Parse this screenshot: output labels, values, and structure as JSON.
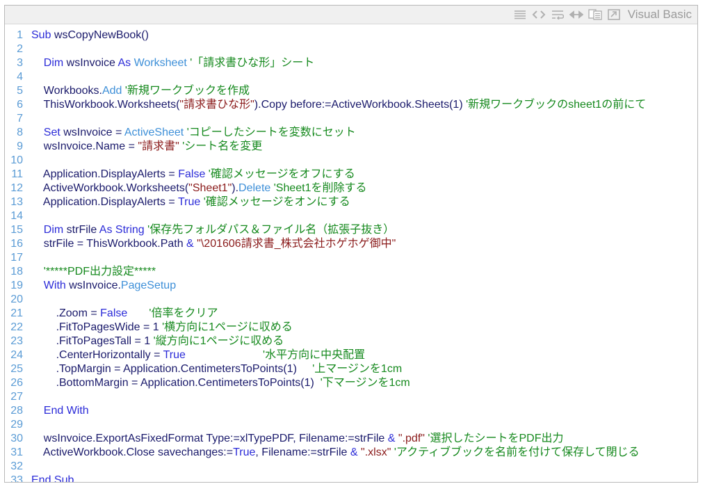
{
  "toolbar": {
    "icons": [
      "view-plain-icon",
      "view-source-icon",
      "wrap-lines-icon",
      "expand-icon",
      "copy-icon",
      "popup-icon"
    ],
    "language": "Visual Basic"
  },
  "colors": {
    "keyword": "#2b2bd8",
    "type": "#3d8fd8",
    "comment": "#15891d",
    "string": "#8a1a1a",
    "plain": "#1a1a6b",
    "line_number": "#5a9bd5"
  },
  "lines": [
    {
      "n": "1",
      "indent": "",
      "tokens": [
        {
          "t": "kw",
          "v": "Sub"
        },
        {
          "t": "pl",
          "v": " wsCopyNewBook()"
        }
      ]
    },
    {
      "n": "2",
      "indent": "",
      "tokens": []
    },
    {
      "n": "3",
      "indent": "    ",
      "tokens": [
        {
          "t": "kw",
          "v": "Dim"
        },
        {
          "t": "pl",
          "v": " wsInvoice "
        },
        {
          "t": "kw",
          "v": "As"
        },
        {
          "t": "pl",
          "v": " "
        },
        {
          "t": "ty",
          "v": "Worksheet"
        },
        {
          "t": "pl",
          "v": " "
        },
        {
          "t": "cm",
          "v": "'「請求書ひな形」シート"
        }
      ]
    },
    {
      "n": "4",
      "indent": "",
      "tokens": []
    },
    {
      "n": "5",
      "indent": "    ",
      "tokens": [
        {
          "t": "pl",
          "v": "Workbooks."
        },
        {
          "t": "ty",
          "v": "Add"
        },
        {
          "t": "pl",
          "v": " "
        },
        {
          "t": "cm",
          "v": "'新規ワークブックを作成"
        }
      ]
    },
    {
      "n": "6",
      "indent": "    ",
      "tokens": [
        {
          "t": "pl",
          "v": "ThisWorkbook.Worksheets("
        },
        {
          "t": "st",
          "v": "\"請求書ひな形\""
        },
        {
          "t": "pl",
          "v": ").Copy before:=ActiveWorkbook.Sheets(1) "
        },
        {
          "t": "cm",
          "v": "'新規ワークブックのsheet1の前にて"
        }
      ]
    },
    {
      "n": "7",
      "indent": "",
      "tokens": []
    },
    {
      "n": "8",
      "indent": "    ",
      "tokens": [
        {
          "t": "kw",
          "v": "Set"
        },
        {
          "t": "pl",
          "v": " wsInvoice = "
        },
        {
          "t": "ty",
          "v": "ActiveSheet"
        },
        {
          "t": "pl",
          "v": " "
        },
        {
          "t": "cm",
          "v": "'コピーしたシートを変数にセット"
        }
      ]
    },
    {
      "n": "9",
      "indent": "    ",
      "tokens": [
        {
          "t": "pl",
          "v": "wsInvoice.Name = "
        },
        {
          "t": "st",
          "v": "\"請求書\""
        },
        {
          "t": "pl",
          "v": " "
        },
        {
          "t": "cm",
          "v": "'シート名を変更"
        }
      ]
    },
    {
      "n": "10",
      "indent": "",
      "tokens": []
    },
    {
      "n": "11",
      "indent": "    ",
      "tokens": [
        {
          "t": "pl",
          "v": "Application.DisplayAlerts = "
        },
        {
          "t": "kw",
          "v": "False"
        },
        {
          "t": "pl",
          "v": " "
        },
        {
          "t": "cm",
          "v": "'確認メッセージをオフにする"
        }
      ]
    },
    {
      "n": "12",
      "indent": "    ",
      "tokens": [
        {
          "t": "pl",
          "v": "ActiveWorkbook.Worksheets("
        },
        {
          "t": "st",
          "v": "\"Sheet1\""
        },
        {
          "t": "pl",
          "v": ")."
        },
        {
          "t": "ty",
          "v": "Delete"
        },
        {
          "t": "pl",
          "v": " "
        },
        {
          "t": "cm",
          "v": "'Sheet1を削除する"
        }
      ]
    },
    {
      "n": "13",
      "indent": "    ",
      "tokens": [
        {
          "t": "pl",
          "v": "Application.DisplayAlerts = "
        },
        {
          "t": "kw",
          "v": "True"
        },
        {
          "t": "pl",
          "v": " "
        },
        {
          "t": "cm",
          "v": "'確認メッセージをオンにする"
        }
      ]
    },
    {
      "n": "14",
      "indent": "",
      "tokens": []
    },
    {
      "n": "15",
      "indent": "    ",
      "tokens": [
        {
          "t": "kw",
          "v": "Dim"
        },
        {
          "t": "pl",
          "v": " strFile "
        },
        {
          "t": "kw",
          "v": "As"
        },
        {
          "t": "pl",
          "v": " "
        },
        {
          "t": "kw",
          "v": "String"
        },
        {
          "t": "pl",
          "v": " "
        },
        {
          "t": "cm",
          "v": "'保存先フォルダパス＆ファイル名（拡張子抜き）"
        }
      ]
    },
    {
      "n": "16",
      "indent": "    ",
      "tokens": [
        {
          "t": "pl",
          "v": "strFile = ThisWorkbook.Path "
        },
        {
          "t": "kw",
          "v": "&"
        },
        {
          "t": "pl",
          "v": " "
        },
        {
          "t": "st",
          "v": "\"\\201606請求書_株式会社ホゲホゲ御中\""
        }
      ]
    },
    {
      "n": "17",
      "indent": "",
      "tokens": []
    },
    {
      "n": "18",
      "indent": "    ",
      "tokens": [
        {
          "t": "cm",
          "v": "'*****PDF出力設定*****"
        }
      ]
    },
    {
      "n": "19",
      "indent": "    ",
      "tokens": [
        {
          "t": "kw",
          "v": "With"
        },
        {
          "t": "pl",
          "v": " wsInvoice."
        },
        {
          "t": "ty",
          "v": "PageSetup"
        }
      ]
    },
    {
      "n": "20",
      "indent": "",
      "tokens": []
    },
    {
      "n": "21",
      "indent": "        ",
      "tokens": [
        {
          "t": "pl",
          "v": ".Zoom = "
        },
        {
          "t": "kw",
          "v": "False"
        },
        {
          "t": "pl",
          "v": "       "
        },
        {
          "t": "cm",
          "v": "'倍率をクリア"
        }
      ]
    },
    {
      "n": "22",
      "indent": "        ",
      "tokens": [
        {
          "t": "pl",
          "v": ".FitToPagesWide = 1 "
        },
        {
          "t": "cm",
          "v": "'横方向に1ページに収める"
        }
      ]
    },
    {
      "n": "23",
      "indent": "        ",
      "tokens": [
        {
          "t": "pl",
          "v": ".FitToPagesTall = 1 "
        },
        {
          "t": "cm",
          "v": "'縦方向に1ページに収める"
        }
      ]
    },
    {
      "n": "24",
      "indent": "        ",
      "tokens": [
        {
          "t": "pl",
          "v": ".CenterHorizontally = "
        },
        {
          "t": "kw",
          "v": "True"
        },
        {
          "t": "pl",
          "v": "                         "
        },
        {
          "t": "cm",
          "v": "'水平方向に中央配置"
        }
      ]
    },
    {
      "n": "25",
      "indent": "        ",
      "tokens": [
        {
          "t": "pl",
          "v": ".TopMargin = Application.CentimetersToPoints(1)     "
        },
        {
          "t": "cm",
          "v": "'上マージンを1cm"
        }
      ]
    },
    {
      "n": "26",
      "indent": "        ",
      "tokens": [
        {
          "t": "pl",
          "v": ".BottomMargin = Application.CentimetersToPoints(1)  "
        },
        {
          "t": "cm",
          "v": "'下マージンを1cm"
        }
      ]
    },
    {
      "n": "27",
      "indent": "",
      "tokens": []
    },
    {
      "n": "28",
      "indent": "    ",
      "tokens": [
        {
          "t": "kw",
          "v": "End With"
        }
      ]
    },
    {
      "n": "29",
      "indent": "",
      "tokens": []
    },
    {
      "n": "30",
      "indent": "    ",
      "tokens": [
        {
          "t": "pl",
          "v": "wsInvoice.ExportAsFixedFormat Type:=xlTypePDF, Filename:=strFile "
        },
        {
          "t": "kw",
          "v": "&"
        },
        {
          "t": "pl",
          "v": " "
        },
        {
          "t": "st",
          "v": "\".pdf\""
        },
        {
          "t": "pl",
          "v": " "
        },
        {
          "t": "cm",
          "v": "'選択したシートをPDF出力"
        }
      ]
    },
    {
      "n": "31",
      "indent": "    ",
      "tokens": [
        {
          "t": "pl",
          "v": "ActiveWorkbook.Close savechanges:="
        },
        {
          "t": "kw",
          "v": "True"
        },
        {
          "t": "pl",
          "v": ", Filename:=strFile "
        },
        {
          "t": "kw",
          "v": "&"
        },
        {
          "t": "pl",
          "v": " "
        },
        {
          "t": "st",
          "v": "\".xlsx\""
        },
        {
          "t": "pl",
          "v": " "
        },
        {
          "t": "cm",
          "v": "'アクティブブックを名前を付けて保存して閉じる"
        }
      ]
    },
    {
      "n": "32",
      "indent": "",
      "tokens": []
    },
    {
      "n": "33",
      "indent": "",
      "tokens": [
        {
          "t": "kw",
          "v": "End Sub"
        }
      ]
    }
  ]
}
